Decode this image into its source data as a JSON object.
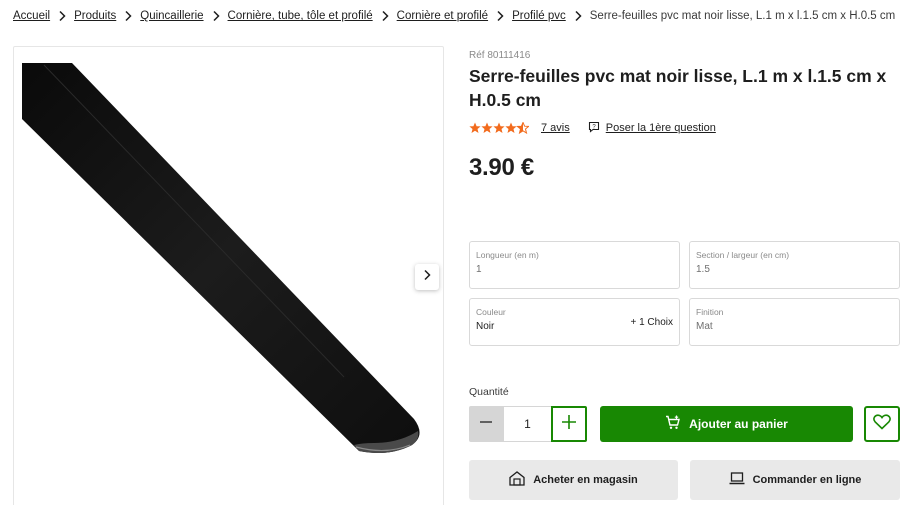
{
  "breadcrumb": {
    "items": [
      "Accueil",
      "Produits",
      "Quincaillerie",
      "Cornière, tube, tôle et profilé",
      "Cornière et profilé",
      "Profilé pvc"
    ],
    "current": "Serre-feuilles pvc mat noir lisse, L.1 m x l.1.5 cm x H.0.5 cm"
  },
  "gallery": {
    "next_icon": "chevron-right-icon"
  },
  "product": {
    "ref": "Réf 80111416",
    "title": "Serre-feuilles pvc mat noir lisse, L.1 m x l.1.5 cm x H.0.5 cm",
    "rating": 4.5,
    "reviews_label": "7 avis",
    "question_label": "Poser la 1ère question",
    "price": "3.90 €"
  },
  "options": {
    "longueur": {
      "label": "Longueur (en m)",
      "value": "1"
    },
    "section": {
      "label": "Section / largeur (en cm)",
      "value": "1.5"
    },
    "couleur": {
      "label": "Couleur",
      "value": "Noir",
      "extra": "+ 1 Choix"
    },
    "finition": {
      "label": "Finition",
      "value": "Mat"
    }
  },
  "purchase": {
    "quantity_label": "Quantité",
    "quantity_value": "1",
    "add_to_cart_label": "Ajouter au panier",
    "store_label": "Acheter en magasin",
    "online_label": "Commander en ligne"
  },
  "colors": {
    "accent_green": "#188803",
    "star_orange": "#f26b1d",
    "text_dark": "#1e1e1e",
    "button_grey": "#e9e9e9"
  }
}
